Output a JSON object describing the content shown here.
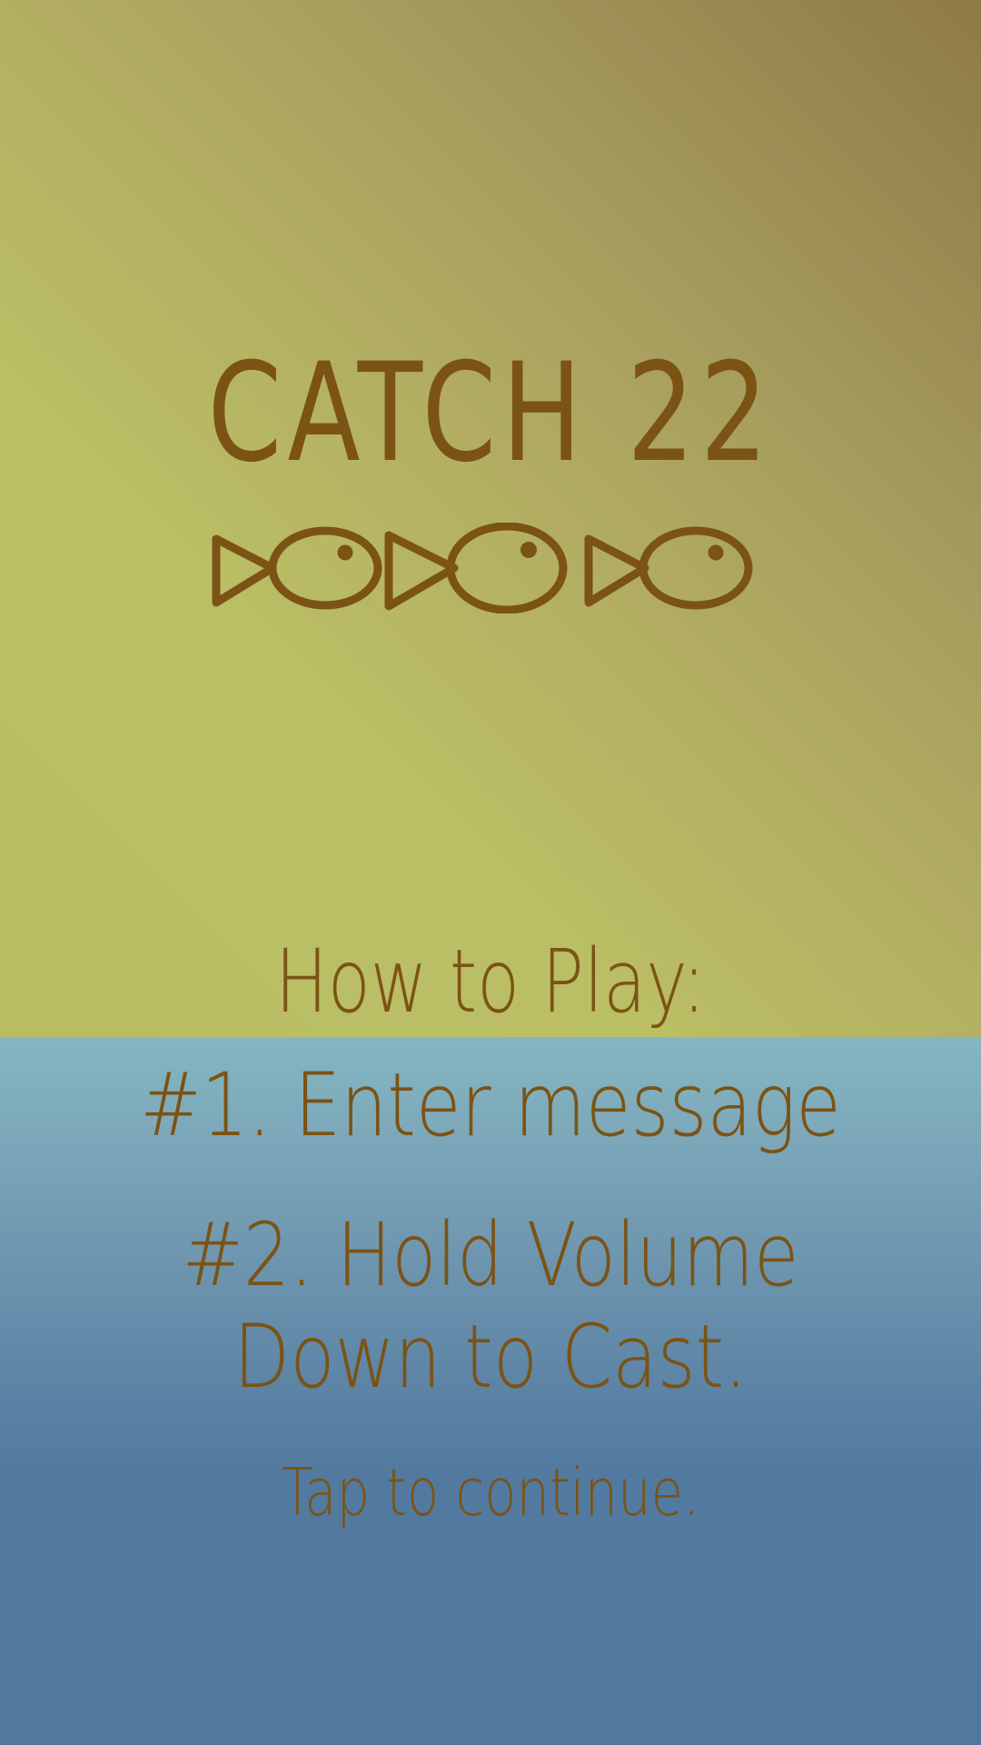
{
  "title": "CATCH 22",
  "instructions": {
    "heading": "How to Play:",
    "step1": "#1. Enter message",
    "step2": "#2. Hold Volume Down to Cast.",
    "continue_prompt": "Tap to continue."
  },
  "icons": [
    "fish-icon",
    "fish-icon",
    "fish-icon"
  ],
  "colors": {
    "text": "#7b5314",
    "sky": "#b4b063",
    "water_top": "#84b6c1",
    "water_bottom": "#51799e"
  }
}
